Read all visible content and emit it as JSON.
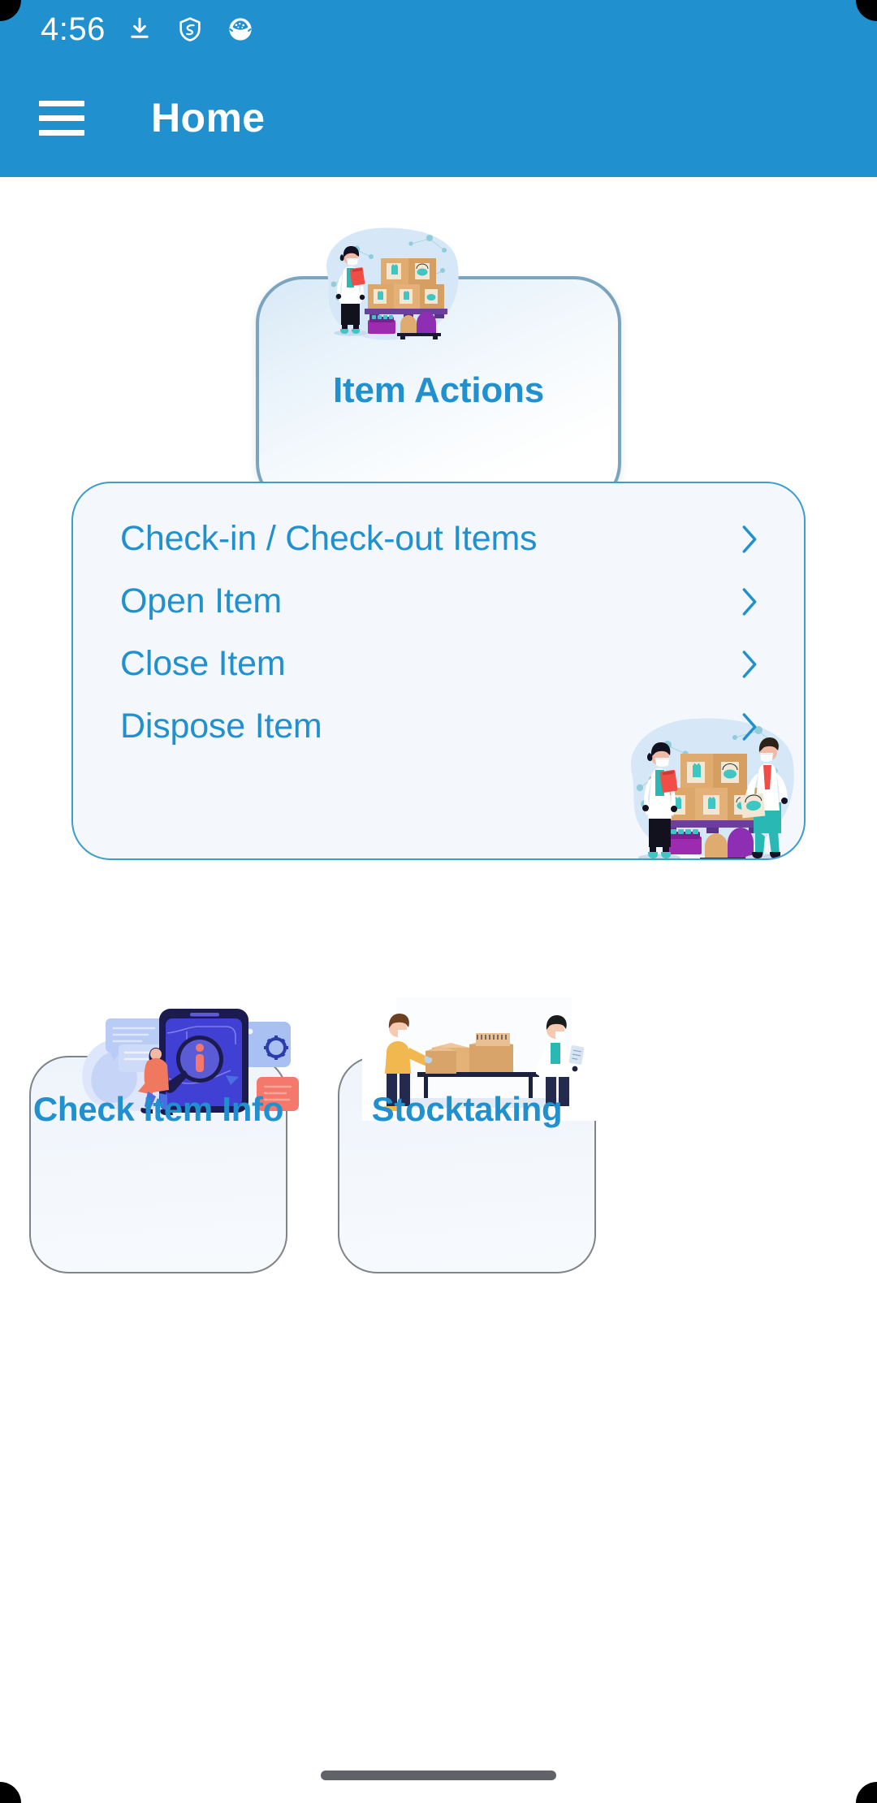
{
  "theme": {
    "primary": "#2190ce",
    "card_bg": "#f4f8fd",
    "card_border": "#3e9ecb",
    "tile_border": "#7f8488",
    "hero_border": "#7ba4be",
    "text_blue": "#2190ce",
    "gesture_bar": "#5f6368"
  },
  "statusbar": {
    "time": "4:56",
    "icons": [
      {
        "name": "download-icon"
      },
      {
        "name": "shield-icon"
      },
      {
        "name": "app-notification-icon"
      }
    ]
  },
  "appbar": {
    "menu_icon": "hamburger-menu-icon",
    "title": "Home"
  },
  "hero": {
    "label": "Item Actions",
    "illustration": "warehouse-ppe-inventory-illustration"
  },
  "actions_list": {
    "items": [
      {
        "label": "Check-in / Check-out Items",
        "chevron": "chevron-right-icon"
      },
      {
        "label": "Open Item",
        "chevron": "chevron-right-icon"
      },
      {
        "label": "Close Item",
        "chevron": "chevron-right-icon"
      },
      {
        "label": "Dispose Item",
        "chevron": "chevron-right-icon"
      }
    ],
    "illustration": "warehouse-ppe-inventory-illustration"
  },
  "tiles": [
    {
      "label": "Check Item Info",
      "illustration": "mobile-info-search-illustration"
    },
    {
      "label": "Stocktaking",
      "illustration": "warehouse-stocktaking-illustration"
    }
  ],
  "navigation": {
    "gesture_bar": "home-gesture-bar"
  }
}
